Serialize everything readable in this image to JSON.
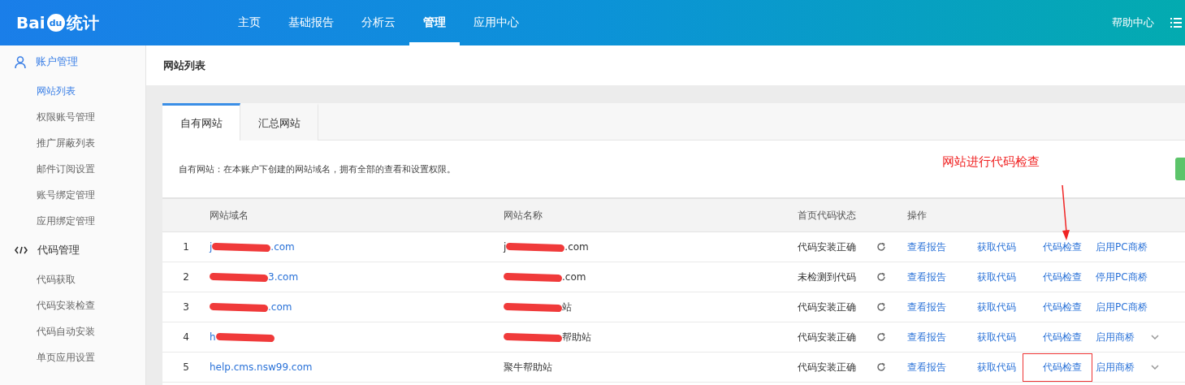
{
  "header": {
    "logo": {
      "latin": "Bai",
      "badge": "du",
      "cn": "统计"
    },
    "nav": [
      {
        "label": "主页",
        "selected": false
      },
      {
        "label": "基础报告",
        "selected": false
      },
      {
        "label": "分析云",
        "selected": false
      },
      {
        "label": "管理",
        "selected": true
      },
      {
        "label": "应用中心",
        "selected": false
      }
    ],
    "help": "帮助中心"
  },
  "sidebar": {
    "groups": [
      {
        "kind": "user",
        "title": "账户管理",
        "selected": true,
        "items": [
          {
            "label": "网站列表",
            "selected": true
          },
          {
            "label": "权限账号管理",
            "selected": false
          },
          {
            "label": "推广屏蔽列表",
            "selected": false
          },
          {
            "label": "邮件订阅设置",
            "selected": false
          },
          {
            "label": "账号绑定管理",
            "selected": false
          },
          {
            "label": "应用绑定管理",
            "selected": false
          }
        ]
      },
      {
        "kind": "code",
        "title": "代码管理",
        "selected": false,
        "items": [
          {
            "label": "代码获取",
            "selected": false
          },
          {
            "label": "代码安装检查",
            "selected": false
          },
          {
            "label": "代码自动安装",
            "selected": false
          },
          {
            "label": "单页应用设置",
            "selected": false
          }
        ]
      }
    ]
  },
  "page_title": "网站列表",
  "tabs": [
    {
      "label": "自有网站",
      "selected": true
    },
    {
      "label": "汇总网站",
      "selected": false
    }
  ],
  "description": "自有网站：在本账户下创建的网站域名，拥有全部的查看和设置权限。",
  "annotation": {
    "text": "网站进行代码检查"
  },
  "table": {
    "columns": [
      "网站域名",
      "网站名称",
      "首页代码状态",
      "操作"
    ],
    "rows": [
      {
        "index": "1",
        "domain": {
          "before": "j",
          "after": ".com",
          "redacted": true
        },
        "name": {
          "before": "j",
          "after": ".com",
          "redacted": true
        },
        "status": "代码安装正确",
        "actions": [
          {
            "label": "查看报告",
            "boxed": false,
            "arrow": false
          },
          {
            "label": "获取代码",
            "boxed": false,
            "arrow": false
          },
          {
            "label": "代码检查",
            "boxed": false,
            "arrow": true
          },
          {
            "label": "启用PC商桥",
            "boxed": false,
            "arrow": false
          }
        ],
        "menu": false
      },
      {
        "index": "2",
        "domain": {
          "after": "3.com",
          "redacted": true
        },
        "name": {
          "after": ".com",
          "redacted": true
        },
        "status": "未检测到代码",
        "actions": [
          {
            "label": "查看报告",
            "boxed": false,
            "arrow": false
          },
          {
            "label": "获取代码",
            "boxed": false,
            "arrow": false
          },
          {
            "label": "代码检查",
            "boxed": false,
            "arrow": false
          },
          {
            "label": "停用PC商桥",
            "boxed": false,
            "arrow": false
          }
        ],
        "menu": false
      },
      {
        "index": "3",
        "domain": {
          "after": ".com",
          "redacted": true
        },
        "name": {
          "after": "站",
          "redacted": true
        },
        "status": "代码安装正确",
        "actions": [
          {
            "label": "查看报告",
            "boxed": false,
            "arrow": false
          },
          {
            "label": "获取代码",
            "boxed": false,
            "arrow": false
          },
          {
            "label": "代码检查",
            "boxed": false,
            "arrow": false
          },
          {
            "label": "启用PC商桥",
            "boxed": false,
            "arrow": false
          }
        ],
        "menu": false
      },
      {
        "index": "4",
        "domain": {
          "before": "h",
          "redacted": true
        },
        "name": {
          "after": "帮助站",
          "redacted": true
        },
        "status": "代码安装正确",
        "actions": [
          {
            "label": "查看报告",
            "boxed": false,
            "arrow": false
          },
          {
            "label": "获取代码",
            "boxed": false,
            "arrow": false
          },
          {
            "label": "代码检查",
            "boxed": false,
            "arrow": false
          },
          {
            "label": "启用商桥",
            "boxed": false,
            "arrow": false
          }
        ],
        "menu": true
      },
      {
        "index": "5",
        "domain": {
          "before": "help.cms.nsw99.com",
          "redacted": false
        },
        "name": {
          "before": "聚牛帮助站",
          "redacted": false
        },
        "status": "代码安装正确",
        "actions": [
          {
            "label": "查看报告",
            "boxed": false,
            "arrow": false
          },
          {
            "label": "获取代码",
            "boxed": false,
            "arrow": false
          },
          {
            "label": "代码检查",
            "boxed": true,
            "arrow": false
          },
          {
            "label": "启用商桥",
            "boxed": false,
            "arrow": false
          }
        ],
        "menu": true
      }
    ]
  }
}
